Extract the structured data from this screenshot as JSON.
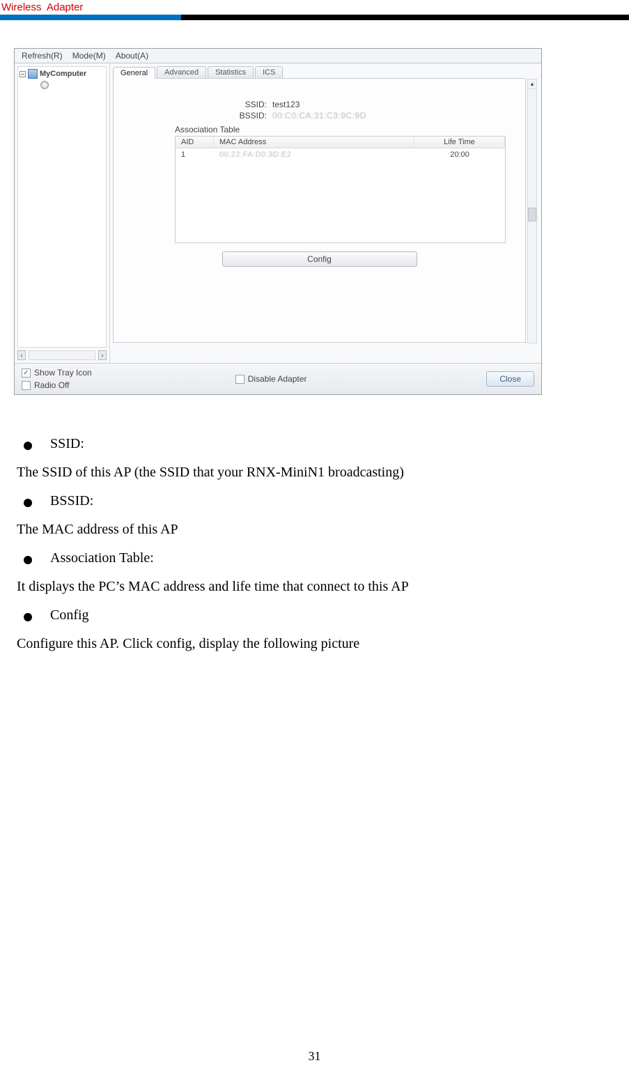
{
  "header": {
    "label": "Wireless  Adapter"
  },
  "menu": {
    "refresh": "Refresh(R)",
    "mode": "Mode(M)",
    "about": "About(A)"
  },
  "tree": {
    "root": "MyComputer"
  },
  "tabs": {
    "general": "General",
    "advanced": "Advanced",
    "statistics": "Statistics",
    "ics": "ICS"
  },
  "general": {
    "ssid_label": "SSID:",
    "ssid_value": "test123",
    "bssid_label": "BSSID:",
    "bssid_value": "00:C0:CA:31:C3:9C:9D",
    "assoc_label": "Association Table",
    "th_aid": "AID",
    "th_mac": "MAC Address",
    "th_life": "Life Time",
    "row1_aid": "1",
    "row1_mac": "00:22:FA:D0:3D:E2",
    "row1_life": "20:00",
    "config_btn": "Config"
  },
  "bottom": {
    "show_tray": "Show Tray Icon",
    "radio_off": "Radio Off",
    "disable_adapter": "Disable Adapter",
    "close": "Close"
  },
  "desc": {
    "b1": "SSID:",
    "t1": "The SSID of this AP (the SSID that your RNX-MiniN1 broadcasting)",
    "b2": "BSSID:",
    "t2": "The MAC address of this AP",
    "b3": "Association Table:",
    "t3": "It displays the PC’s MAC address and life time that connect to this AP",
    "b4": "Config",
    "t4": "Configure this AP. Click config, display the following picture"
  },
  "page_number": "31"
}
